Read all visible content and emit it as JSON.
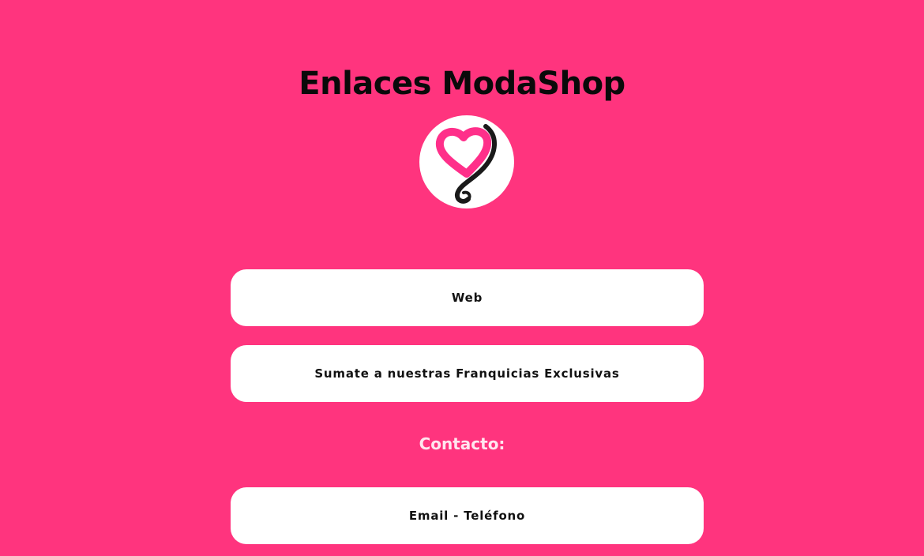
{
  "page": {
    "title": "Enlaces ModaShop",
    "background_color": "#ff347e"
  },
  "logo": {
    "icon": "heart-swirl-logo-icon",
    "heart_color": "#ff2f8a",
    "stroke_color": "#1a1a1a"
  },
  "links": [
    {
      "label": "Web"
    },
    {
      "label": "Sumate a nuestras Franquicias Exclusivas"
    }
  ],
  "contact": {
    "label": "Contacto:",
    "button_label": "Email - Teléfono"
  }
}
